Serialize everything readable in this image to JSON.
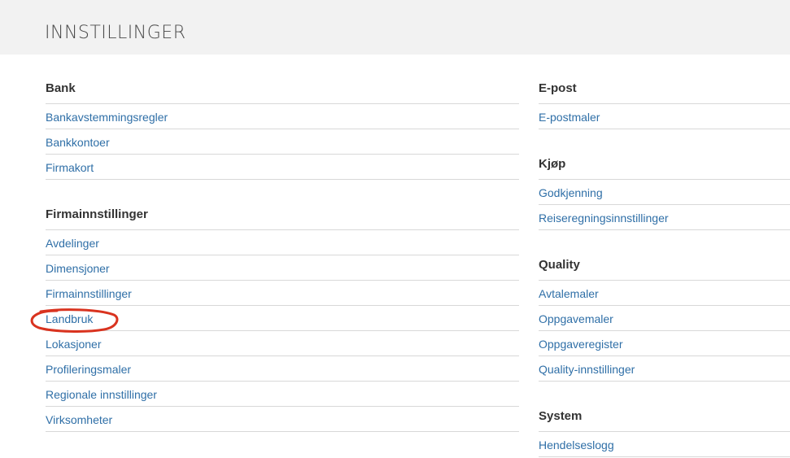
{
  "page": {
    "title": "INNSTILLINGER"
  },
  "left_column": {
    "sections": [
      {
        "title": "Bank",
        "links": [
          "Bankavstemmingsregler",
          "Bankkontoer",
          "Firmakort"
        ]
      },
      {
        "title": "Firmainnstillinger",
        "links": [
          "Avdelinger",
          "Dimensjoner",
          "Firmainnstillinger",
          "Landbruk",
          "Lokasjoner",
          "Profileringsmaler",
          "Regionale innstillinger",
          "Virksomheter"
        ]
      }
    ]
  },
  "right_column": {
    "sections": [
      {
        "title": "E-post",
        "links": [
          "E-postmaler"
        ]
      },
      {
        "title": "Kjøp",
        "links": [
          "Godkjenning",
          "Reiseregningsinnstillinger"
        ]
      },
      {
        "title": "Quality",
        "links": [
          "Avtalemaler",
          "Oppgavemaler",
          "Oppgaveregister",
          "Quality-innstillinger"
        ]
      },
      {
        "title": "System",
        "links": [
          "Hendelseslogg"
        ]
      }
    ]
  },
  "annotation": {
    "highlighted_item": "Landbruk",
    "color": "#d9331f"
  },
  "colors": {
    "link": "#2f6fa7",
    "header_bg": "#f2f2f2",
    "divider": "#d8d8d8"
  }
}
